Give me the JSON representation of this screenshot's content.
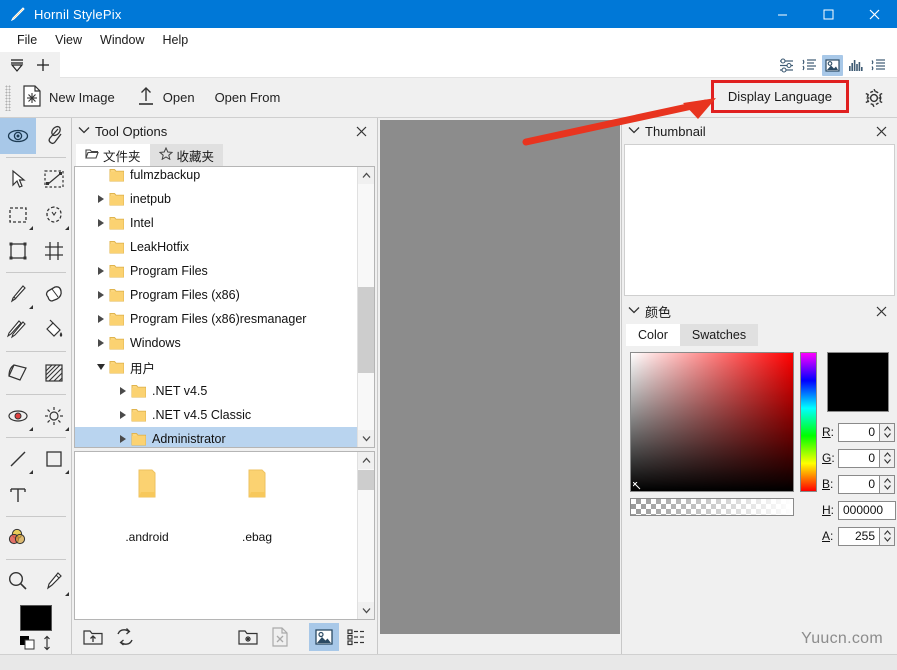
{
  "window": {
    "title": "Hornil StylePix",
    "app_icon": "pencil-icon",
    "minimize": "–",
    "maximize": "❐",
    "close": "✕",
    "titlebar_color": "#0078d7"
  },
  "menubar": {
    "items": [
      {
        "label": "File"
      },
      {
        "label": "View"
      },
      {
        "label": "Window"
      },
      {
        "label": "Help"
      }
    ]
  },
  "tabstrip": {
    "buttons": [
      {
        "name": "tab-list-dropdown-icon",
        "glyph": "▽"
      },
      {
        "name": "new-tab-icon",
        "glyph": "+"
      }
    ],
    "right_icons": [
      {
        "name": "tool-options-toggle-icon",
        "active": false
      },
      {
        "name": "layers-toggle-icon",
        "active": false
      },
      {
        "name": "thumbnail-toggle-icon",
        "active": true
      },
      {
        "name": "histogram-toggle-icon",
        "active": false
      },
      {
        "name": "properties-toggle-icon",
        "active": false
      }
    ]
  },
  "toolbar": {
    "new_image": "New Image",
    "open": "Open",
    "open_from": "Open From",
    "display_language": "Display Language",
    "settings_icon": "gear-icon",
    "highlight_color": "#e02020"
  },
  "tool_palette": {
    "tools": [
      {
        "name": "visibility-eye-tool",
        "selected": true,
        "submenu": false
      },
      {
        "name": "attachment-clip-tool",
        "selected": false,
        "submenu": false
      },
      {
        "name": "pointer-select-tool",
        "selected": false,
        "submenu": false
      },
      {
        "name": "transform-select-tool",
        "selected": false,
        "submenu": false
      },
      {
        "name": "rectangle-marquee-tool",
        "selected": false,
        "submenu": true
      },
      {
        "name": "lasso-select-tool",
        "selected": false,
        "submenu": true
      },
      {
        "name": "crop-tool",
        "selected": false,
        "submenu": false
      },
      {
        "name": "slice-grid-tool",
        "selected": false,
        "submenu": false
      },
      {
        "name": "brush-tool",
        "selected": false,
        "submenu": true
      },
      {
        "name": "eraser-tool",
        "selected": false,
        "submenu": false
      },
      {
        "name": "clone-stamp-tool",
        "selected": false,
        "submenu": false
      },
      {
        "name": "paint-bucket-tool",
        "selected": false,
        "submenu": false
      },
      {
        "name": "gradient-tool",
        "selected": false,
        "submenu": false
      },
      {
        "name": "pattern-fill-tool",
        "selected": false,
        "submenu": false
      },
      {
        "name": "red-eye-tool",
        "selected": false,
        "submenu": true
      },
      {
        "name": "brightness-tool",
        "selected": false,
        "submenu": true
      },
      {
        "name": "line-tool",
        "selected": false,
        "submenu": true
      },
      {
        "name": "rectangle-shape-tool",
        "selected": false,
        "submenu": true
      },
      {
        "name": "text-tool",
        "selected": false,
        "submenu": false
      },
      {
        "name": "color-blend-tool",
        "selected": false,
        "submenu": false
      },
      {
        "name": "zoom-tool",
        "selected": false,
        "submenu": false
      },
      {
        "name": "eyedropper-tool",
        "selected": false,
        "submenu": true
      }
    ],
    "foreground_color": "#000000",
    "background_color": "#ffffff"
  },
  "tool_options_panel": {
    "title": "Tool Options",
    "close_icon": "close-icon",
    "collapse_icon": "chevron-down-icon",
    "tabs": [
      {
        "label": "文件夹",
        "icon": "folder-icon",
        "active": true
      },
      {
        "label": "收藏夹",
        "icon": "star-icon",
        "active": false
      }
    ],
    "tree": [
      {
        "label": "fulmzbackup",
        "indent": 0,
        "expander": "none",
        "selected": false,
        "clipped": true
      },
      {
        "label": "inetpub",
        "indent": 0,
        "expander": "collapsed",
        "selected": false
      },
      {
        "label": "Intel",
        "indent": 0,
        "expander": "collapsed",
        "selected": false
      },
      {
        "label": "LeakHotfix",
        "indent": 0,
        "expander": "none",
        "selected": false
      },
      {
        "label": "Program Files",
        "indent": 0,
        "expander": "collapsed",
        "selected": false
      },
      {
        "label": "Program Files (x86)",
        "indent": 0,
        "expander": "collapsed",
        "selected": false
      },
      {
        "label": "Program Files (x86)resmanager",
        "indent": 0,
        "expander": "collapsed",
        "selected": false
      },
      {
        "label": "Windows",
        "indent": 0,
        "expander": "collapsed",
        "selected": false
      },
      {
        "label": "用户",
        "indent": 0,
        "expander": "expanded",
        "selected": false
      },
      {
        "label": ".NET v4.5",
        "indent": 1,
        "expander": "collapsed",
        "selected": false
      },
      {
        "label": ".NET v4.5 Classic",
        "indent": 1,
        "expander": "collapsed",
        "selected": false
      },
      {
        "label": "Administrator",
        "indent": 1,
        "expander": "collapsed",
        "selected": true
      }
    ],
    "thumbnails": [
      {
        "label": ".android",
        "icon": "folder-icon"
      },
      {
        "label": ".ebag",
        "icon": "folder-icon"
      }
    ],
    "browser_toolbar": [
      {
        "name": "go-up-folder-icon",
        "active": false
      },
      {
        "name": "refresh-icon",
        "active": false
      },
      {
        "name": "new-folder-icon",
        "active": false
      },
      {
        "name": "delete-file-icon",
        "active": false
      },
      {
        "name": "thumbnail-view-icon",
        "active": true
      },
      {
        "name": "list-view-icon",
        "active": false
      }
    ]
  },
  "thumbnail_panel": {
    "title": "Thumbnail",
    "close_icon": "close-icon",
    "collapse_icon": "chevron-down-icon"
  },
  "color_panel": {
    "title": "颜色",
    "close_icon": "close-icon",
    "collapse_icon": "chevron-down-icon",
    "tabs": [
      {
        "label": "Color",
        "active": true
      },
      {
        "label": "Swatches",
        "active": false
      }
    ],
    "preview_color": "#000000",
    "fields": [
      {
        "label": "R",
        "value": "0",
        "spinner": true
      },
      {
        "label": "G",
        "value": "0",
        "spinner": true
      },
      {
        "label": "B",
        "value": "0",
        "spinner": true
      },
      {
        "label": "H",
        "value": "000000",
        "spinner": false
      },
      {
        "label": "A",
        "value": "255",
        "spinner": true
      }
    ]
  },
  "canvas": {
    "background_color": "#8c8c8c"
  },
  "watermark": {
    "text": "Yuucn.com"
  },
  "annotation": {
    "arrow_color": "#e8341f",
    "target": "Display Language"
  }
}
